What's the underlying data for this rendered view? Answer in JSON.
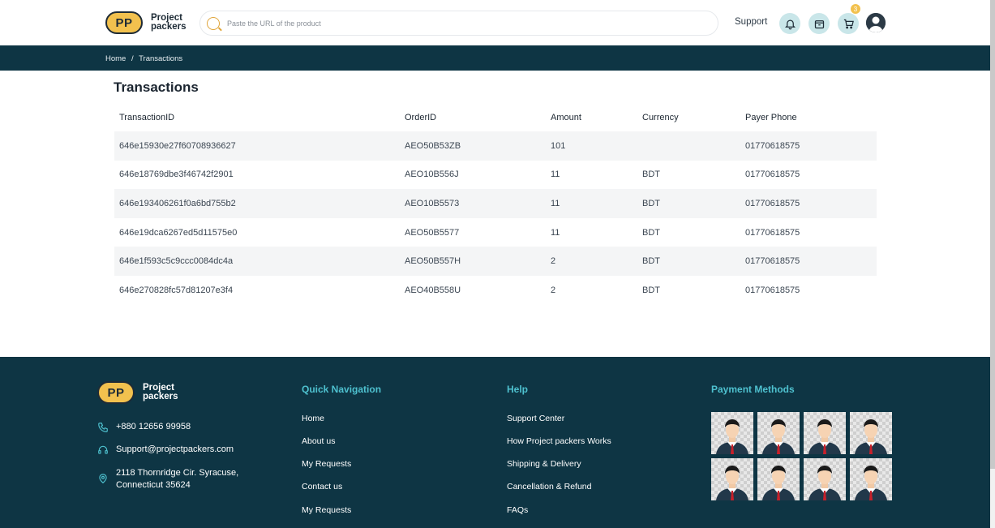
{
  "header": {
    "logo_initials": "PP",
    "logo_line1": "Project",
    "logo_line2": "packers",
    "search_placeholder": "Paste the URL of the product",
    "support_label": "Support",
    "cart_count": "3"
  },
  "breadcrumb": {
    "home": "Home",
    "separator": "/",
    "current": "Transactions"
  },
  "page": {
    "title": "Transactions"
  },
  "table": {
    "headers": [
      "TransactionID",
      "OrderID",
      "Amount",
      "Currency",
      "Payer Phone"
    ],
    "rows": [
      [
        "646e15930e27f60708936627",
        "AEO50B53ZB",
        "101",
        "",
        "01770618575"
      ],
      [
        "646e18769dbe3f46742f2901",
        "AEO10B556J",
        "11",
        "BDT",
        "01770618575"
      ],
      [
        "646e193406261f0a6bd755b2",
        "AEO10B5573",
        "11",
        "BDT",
        "01770618575"
      ],
      [
        "646e19dca6267ed5d11575e0",
        "AEO50B5577",
        "11",
        "BDT",
        "01770618575"
      ],
      [
        "646e1f593c5c9ccc0084dc4a",
        "AEO50B557H",
        "2",
        "BDT",
        "01770618575"
      ],
      [
        "646e270828fc57d81207e3f4",
        "AEO40B558U",
        "2",
        "BDT",
        "01770618575"
      ]
    ]
  },
  "footer": {
    "logo_initials": "PP",
    "logo_line1": "Project",
    "logo_line2": "packers",
    "phone": "+880 12656 99958",
    "email": "Support@projectpackers.com",
    "address_line1": "2118 Thornridge Cir. Syracuse,",
    "address_line2": "Connecticut 35624",
    "quick_nav_title": "Quick Navigation",
    "quick_nav": [
      "Home",
      "About us",
      "My Requests",
      "Contact us",
      "My Requests"
    ],
    "help_title": "Help",
    "help": [
      "Support Center",
      "How Project packers Works",
      "Shipping & Delivery",
      "Cancellation & Refund",
      "FAQs"
    ],
    "payment_title": "Payment Methods",
    "payment_tiles": 8
  },
  "colors": {
    "brand_dark": "#0e3544",
    "brand_accent": "#4ec1cf",
    "logo_yellow": "#f2c14e"
  },
  "icons": {
    "search": "search-icon",
    "notification": "bell-icon",
    "orders": "box-icon",
    "cart": "cart-icon",
    "phone": "phone-icon",
    "email": "headset-icon",
    "address": "location-pin-icon"
  }
}
